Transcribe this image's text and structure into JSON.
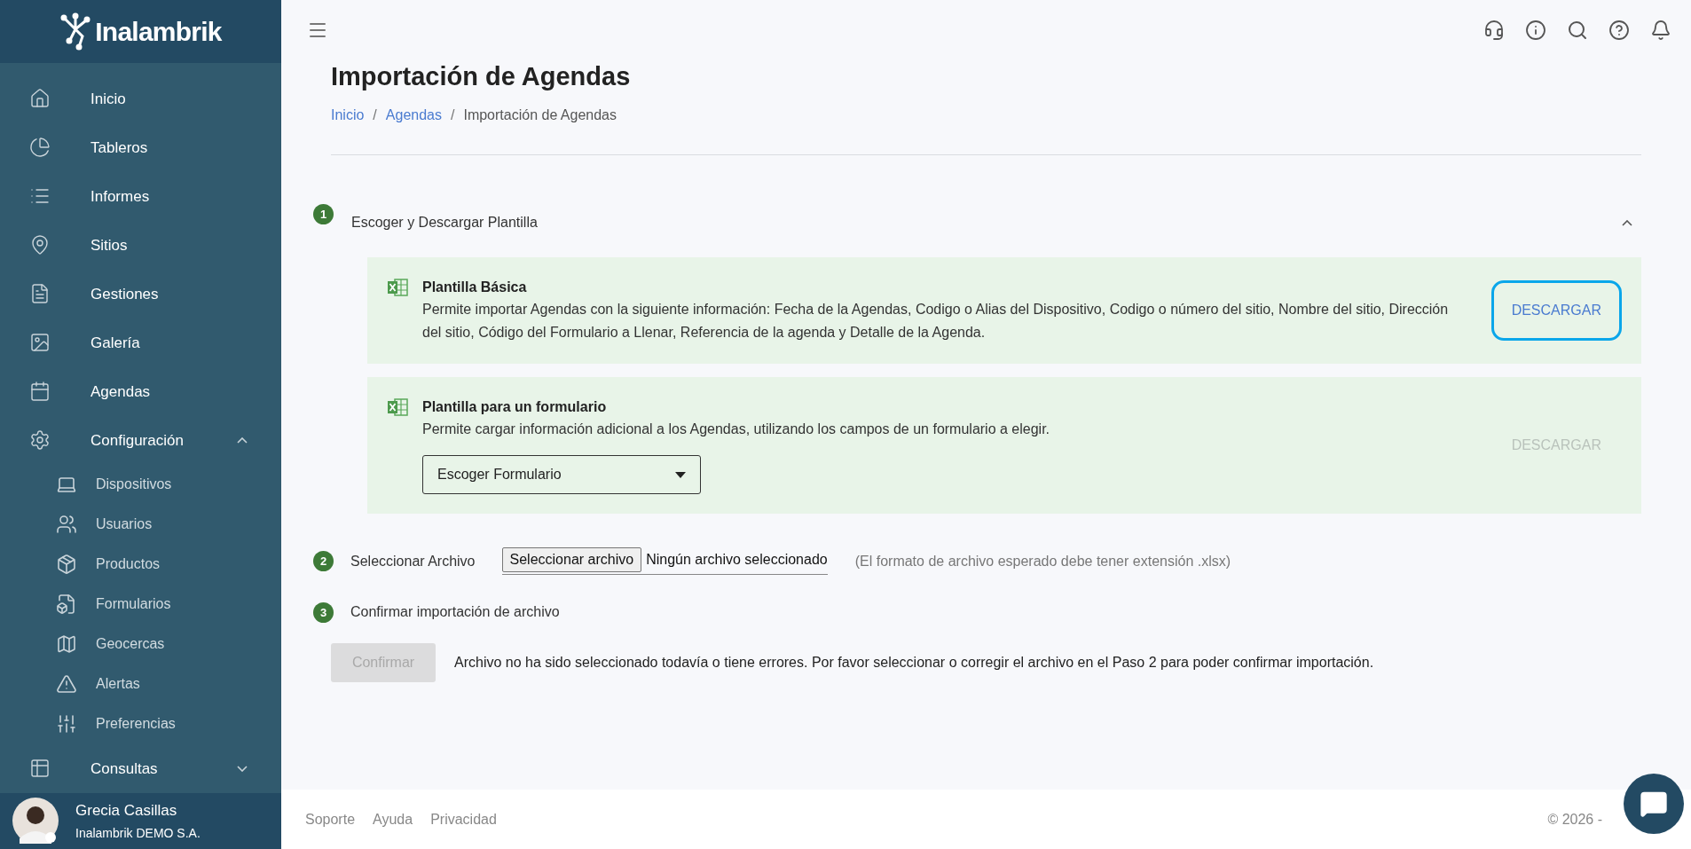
{
  "sidebar": {
    "logo": "Inalambrik",
    "items": [
      {
        "label": "Inicio"
      },
      {
        "label": "Tableros"
      },
      {
        "label": "Informes"
      },
      {
        "label": "Sitios"
      },
      {
        "label": "Gestiones"
      },
      {
        "label": "Galería"
      },
      {
        "label": "Agendas"
      },
      {
        "label": "Configuración",
        "expanded": true,
        "children": [
          {
            "label": "Dispositivos"
          },
          {
            "label": "Usuarios"
          },
          {
            "label": "Productos"
          },
          {
            "label": "Formularios"
          },
          {
            "label": "Geocercas"
          },
          {
            "label": "Alertas"
          },
          {
            "label": "Preferencias"
          }
        ]
      },
      {
        "label": "Consultas",
        "expanded": false
      }
    ],
    "user": {
      "name": "Grecia Casillas",
      "company": "Inalambrik DEMO S.A."
    }
  },
  "page": {
    "title": "Importación de Agendas",
    "breadcrumb_separator": "/",
    "breadcrumb": [
      {
        "label": "Inicio",
        "kind": "link"
      },
      {
        "label": "Agendas",
        "kind": "link"
      },
      {
        "label": "Importación de Agendas",
        "kind": "current"
      }
    ]
  },
  "step1": {
    "number": "1",
    "title": "Escoger y Descargar Plantilla",
    "expanded": true,
    "templates": [
      {
        "title": "Plantilla Básica",
        "description": "Permite importar Agendas con la siguiente información: Fecha de la Agendas, Codigo o Alias del Dispositivo, Codigo o número del sitio, Nombre del sitio, Dirección del sitio, Código del Formulario a Llenar, Referencia de la agenda y Detalle de la Agenda.",
        "button": {
          "label": "DESCARGAR",
          "disabled": false,
          "focused": true
        }
      },
      {
        "title": "Plantilla para un formulario",
        "description": "Permite cargar información adicional a los Agendas, utilizando los campos de un formulario a elegir.",
        "select": {
          "value": "Escoger Formulario"
        },
        "button": {
          "label": "DESCARGAR",
          "disabled": true,
          "focused": false
        }
      }
    ]
  },
  "step2": {
    "number": "2",
    "title": "Seleccionar Archivo",
    "file_button": "Seleccionar archivo",
    "file_status": "Ningún archivo seleccionado",
    "hint": "(El formato de archivo esperado debe tener extensión .xlsx)"
  },
  "step3": {
    "number": "3",
    "title": "Confirmar importación de archivo",
    "button": {
      "label": "Confirmar",
      "disabled": true
    },
    "message": "Archivo no ha sido seleccionado todavía o tiene errores. Por favor seleccionar o corregir el archivo en el Paso 2 para poder confirmar importación."
  },
  "footer": {
    "links": [
      "Soporte",
      "Ayuda",
      "Privacidad"
    ],
    "copyright": "© 2026 -"
  }
}
